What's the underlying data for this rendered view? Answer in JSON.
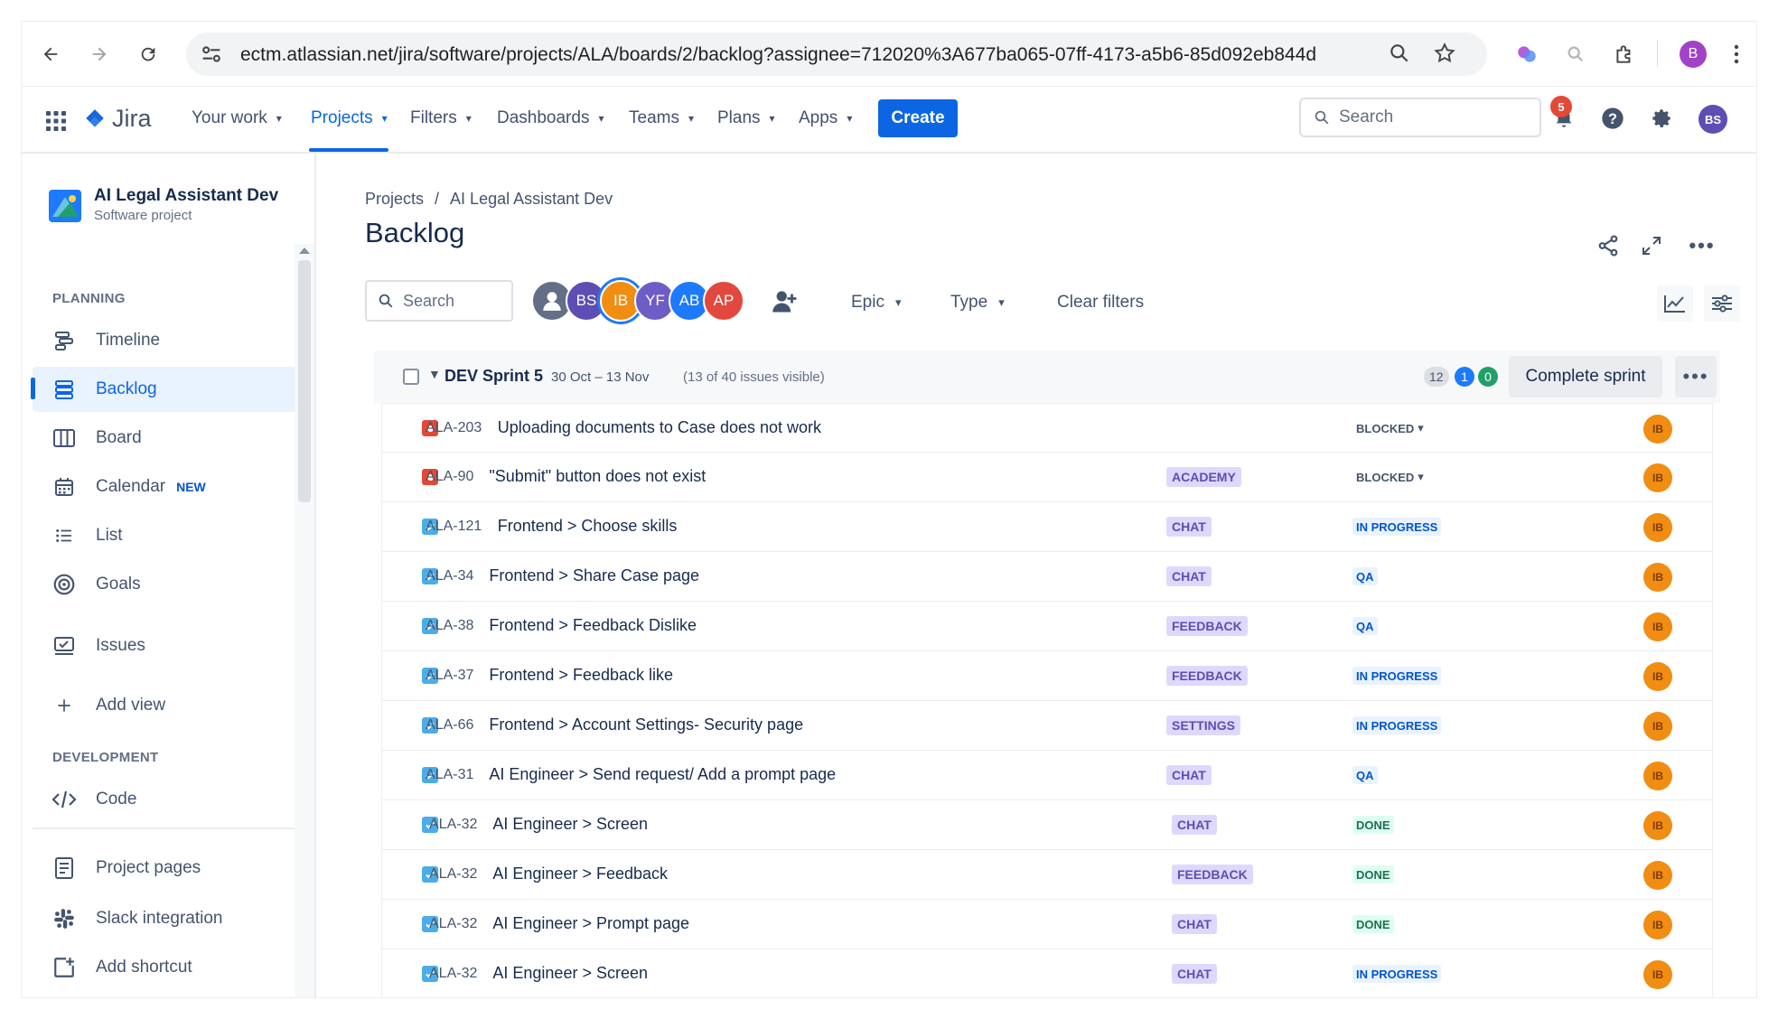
{
  "browser": {
    "url": "ectm.atlassian.net/jira/software/projects/ALA/boards/2/backlog?assignee=712020%3A677ba065-07ff-4173-a5b6-85d092eb844d",
    "profile_initial": "B"
  },
  "topnav": {
    "logo": "Jira",
    "items": [
      "Your work",
      "Projects",
      "Filters",
      "Dashboards",
      "Teams",
      "Plans",
      "Apps"
    ],
    "create": "Create",
    "search_placeholder": "Search",
    "notifications": "5",
    "avatar": "BS"
  },
  "sidebar": {
    "project_name": "AI Legal Assistant Dev",
    "project_type": "Software project",
    "planning_heading": "PLANNING",
    "timeline": "Timeline",
    "backlog": "Backlog",
    "board": "Board",
    "calendar": "Calendar",
    "calendar_tag": "NEW",
    "list": "List",
    "goals": "Goals",
    "issues": "Issues",
    "add_view": "Add view",
    "development_heading": "DEVELOPMENT",
    "code": "Code",
    "project_pages": "Project pages",
    "slack": "Slack integration",
    "add_shortcut": "Add shortcut"
  },
  "main": {
    "breadcrumb": [
      "Projects",
      "/",
      "AI Legal Assistant Dev"
    ],
    "title": "Backlog",
    "filter_search_placeholder": "Search",
    "avatars": [
      {
        "initials": "",
        "color": "#626f86"
      },
      {
        "initials": "BS",
        "color": "#5e4db2"
      },
      {
        "initials": "IB",
        "color": "#f18d13"
      },
      {
        "initials": "YF",
        "color": "#6e5dc6"
      },
      {
        "initials": "AB",
        "color": "#1d7afc"
      },
      {
        "initials": "AP",
        "color": "#e2483d"
      }
    ],
    "epic_filter": "Epic",
    "type_filter": "Type",
    "clear_filters": "Clear filters"
  },
  "sprint": {
    "name": "DEV Sprint 5",
    "dates": "30 Oct – 13 Nov",
    "visible": "(13 of 40 issues visible)",
    "count_todo": "12",
    "count_inprogress": "1",
    "count_done": "0",
    "complete_button": "Complete sprint"
  },
  "issues": [
    {
      "type": "bug",
      "key": "ALA-203",
      "summary": "Uploading documents to Case does not work",
      "epic": "",
      "status": "BLOCKED",
      "assignee": "IB"
    },
    {
      "type": "bug",
      "key": "ALA-90",
      "summary": "\"Submit\" button does not exist",
      "epic": "ACADEMY",
      "status": "BLOCKED",
      "assignee": "IB"
    },
    {
      "type": "task",
      "key": "ALA-121",
      "summary": "Frontend > Choose skills",
      "epic": "CHAT",
      "status": "IN PROGRESS",
      "assignee": "IB"
    },
    {
      "type": "task",
      "key": "ALA-34",
      "summary": "Frontend > Share Case page",
      "epic": "CHAT",
      "status": "QA",
      "assignee": "IB"
    },
    {
      "type": "task",
      "key": "ALA-38",
      "summary": "Frontend > Feedback Dislike",
      "epic": "FEEDBACK",
      "status": "QA",
      "assignee": "IB"
    },
    {
      "type": "task",
      "key": "ALA-37",
      "summary": "Frontend > Feedback like",
      "epic": "FEEDBACK",
      "status": "IN PROGRESS",
      "assignee": "IB"
    },
    {
      "type": "task",
      "key": "ALA-66",
      "summary": "Frontend > Account Settings- Security page",
      "epic": "SETTINGS",
      "status": "IN PROGRESS",
      "assignee": "IB"
    },
    {
      "type": "task",
      "key": "ALA-31",
      "summary": "AI Engineer > Send request/ Add a prompt page",
      "epic": "CHAT",
      "status": "QA",
      "assignee": "IB"
    },
    {
      "type": "task",
      "key": "ALA-32",
      "summary": "AI Engineer > Screen",
      "epic": "CHAT",
      "status": "DONE",
      "assignee": "IB"
    },
    {
      "type": "task",
      "key": "ALA-32",
      "summary": "AI Engineer > Feedback",
      "epic": "FEEDBACK",
      "status": "DONE",
      "assignee": "IB"
    },
    {
      "type": "task",
      "key": "ALA-32",
      "summary": "AI Engineer > Prompt page",
      "epic": "CHAT",
      "status": "DONE",
      "assignee": "IB"
    },
    {
      "type": "task",
      "key": "ALA-32",
      "summary": "AI Engineer > Screen",
      "epic": "CHAT",
      "status": "IN PROGRESS",
      "assignee": "IB"
    }
  ],
  "colors": {
    "accent": "#0c66e4",
    "epic_bg": "#dfd8fd",
    "epic_fg": "#5e4db2",
    "status_inprogress_bg": "#e9f2ff",
    "status_inprogress_fg": "#0055cc",
    "status_done_bg": "#dcfff1",
    "status_done_fg": "#216e4e",
    "status_blocked_fg": "#44546f"
  }
}
